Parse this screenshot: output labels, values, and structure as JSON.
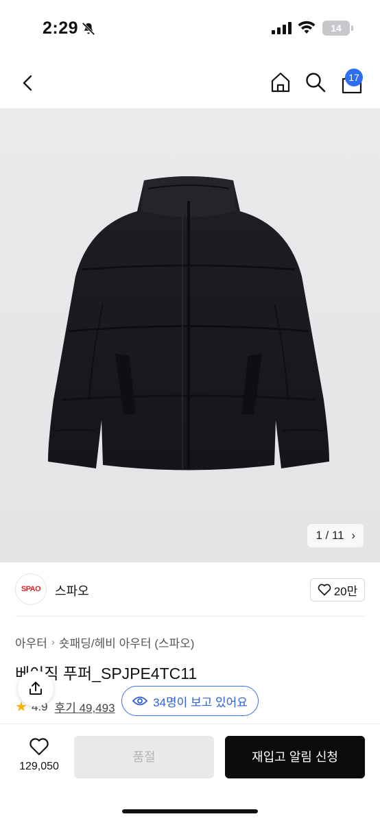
{
  "status_bar": {
    "time": "2:29",
    "battery": "14",
    "icons": [
      "bell-slash-icon",
      "signal-icon",
      "wifi-icon",
      "battery-icon"
    ]
  },
  "nav": {
    "icons": [
      "back-icon",
      "home-icon",
      "search-icon",
      "cart-icon"
    ],
    "cart_count": "17"
  },
  "gallery": {
    "pager": "1 / 11",
    "pager_icon": "chevron-right-icon"
  },
  "brand": {
    "logo_text": "SPAO",
    "name": "스파오",
    "like_count": "20만"
  },
  "product": {
    "breadcrumb": [
      "아우터",
      "숏패딩/헤비 아우터 (스파오)"
    ],
    "title": "베이직 푸퍼_SPJPE4TC11",
    "rating": "4.9",
    "reviews": "후기 49,493"
  },
  "viewers": {
    "text": "34명이 보고 있어요"
  },
  "bottom": {
    "wish_count": "129,050",
    "soldout_label": "품절",
    "restock_label": "재입고 알림 신청"
  },
  "colors": {
    "accent_blue": "#2d6ff0",
    "brand_red": "#d4252b",
    "button_dark": "#0c0c0c"
  }
}
